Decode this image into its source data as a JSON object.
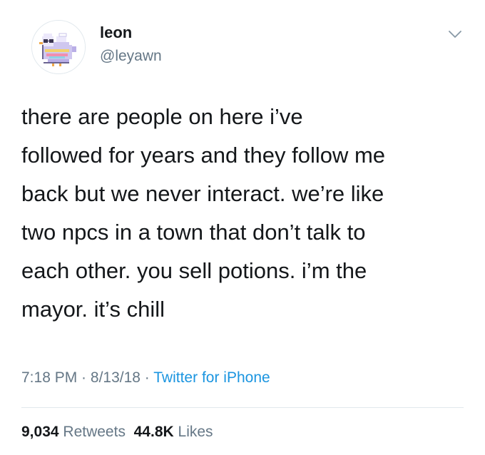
{
  "user": {
    "display_name": "leon",
    "handle": "@leyawn",
    "avatar_icon": "pixel-bird-avatar-icon"
  },
  "menu": {
    "icon": "chevron-down-icon"
  },
  "tweet": {
    "lines": [
      "there are people on here i’ve",
      "followed for years and they follow me",
      "back but we never interact. we’re like",
      "two npcs in a town that don’t talk to",
      "each other. you sell potions. i’m the",
      "mayor. it’s chill"
    ]
  },
  "meta": {
    "time": "7:18 PM",
    "separator": " · ",
    "date": "8/13/18",
    "source": "Twitter for iPhone",
    "source_color": "#1b95e0"
  },
  "stats": {
    "retweets_count": "9,034",
    "retweets_label": "Retweets",
    "likes_count": "44.8K",
    "likes_label": "Likes"
  }
}
